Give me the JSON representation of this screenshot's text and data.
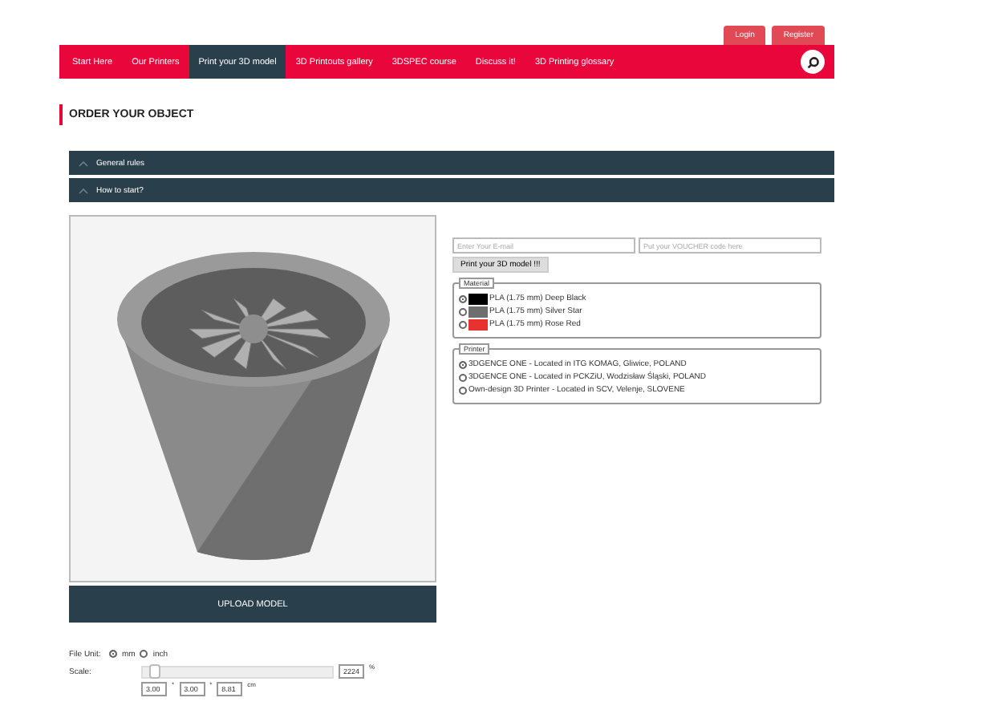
{
  "auth_buttons": [
    "Login",
    "Register"
  ],
  "nav": {
    "items": [
      {
        "label": "Start Here",
        "selected": false
      },
      {
        "label": "Our Printers",
        "selected": false
      },
      {
        "label": "Print your 3D model",
        "selected": true
      },
      {
        "label": "3D Printouts gallery",
        "selected": false
      },
      {
        "label": "3DSPEC course",
        "selected": false
      },
      {
        "label": "Discuss it!",
        "selected": false
      },
      {
        "label": "3D Printing glossary",
        "selected": false
      }
    ]
  },
  "title": "ORDER YOUR OBJECT",
  "accordions": [
    {
      "label": "General rules"
    },
    {
      "label": "How to start?"
    }
  ],
  "form": {
    "email": {
      "placeholder": "Enter Your E-mail"
    },
    "voucher": {
      "placeholder": "Put your VOUCHER code here"
    },
    "submit": "Print your 3D model !!!",
    "material": {
      "legend": "Material",
      "options": [
        {
          "label": "PLA (1.75 mm) Deep Black",
          "color": "#000000",
          "selected": true
        },
        {
          "label": "PLA (1.75 mm) Silver Star",
          "color": "#6e6e6e",
          "selected": false
        },
        {
          "label": "PLA (1.75 mm) Rose Red",
          "color": "#e8322f",
          "selected": false
        }
      ]
    },
    "printer": {
      "legend": "Printer",
      "options": [
        {
          "label": "3DGENCE ONE - Located in ITG KOMAG, Gliwice, POLAND",
          "selected": true
        },
        {
          "label": "3DGENCE ONE - Located in PCKZiU, Wodzisław Śląski, POLAND",
          "selected": false
        },
        {
          "label": "Own-design 3D Printer - Located in SCV, Velenje, SLOVENE",
          "selected": false
        }
      ]
    }
  },
  "upload_button": "UPLOAD MODEL",
  "file_unit": {
    "label": "File Unit:",
    "options": [
      {
        "label": "mm",
        "selected": true
      },
      {
        "label": "inch",
        "selected": false
      }
    ]
  },
  "scale": {
    "label": "Scale:",
    "level": 0.03,
    "value": "2224",
    "unit": "%"
  },
  "dimensions": {
    "values": [
      "3.00",
      "3.00",
      "8.81"
    ],
    "separator": "*",
    "unit": "cm"
  }
}
